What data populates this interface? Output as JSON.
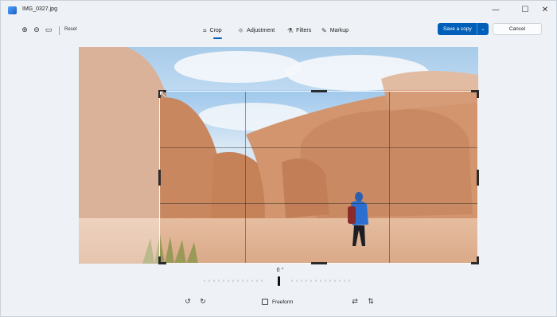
{
  "window": {
    "title": "IMG_0327.jpg",
    "controls": [
      "minimize-icon",
      "maximize-icon",
      "close-icon"
    ]
  },
  "toolbar": {
    "zoom_in_icon": "zoom-in-icon",
    "zoom_out_icon": "zoom-out-icon",
    "fit_icon": "fit-to-window-icon",
    "reset_label": "Reset",
    "tabs": [
      {
        "label": "Crop",
        "icon": "crop-icon",
        "selected": true
      },
      {
        "label": "Adjustment",
        "icon": "adjustment-icon",
        "selected": false
      },
      {
        "label": "Filters",
        "icon": "filters-icon",
        "selected": false
      },
      {
        "label": "Markup",
        "icon": "markup-pen-icon",
        "selected": false
      }
    ],
    "save_label": "Save a copy",
    "cancel_label": "Cancel"
  },
  "rotation": {
    "angle_label": "0 °"
  },
  "bottom": {
    "aspect_label": "Freeform",
    "icons": [
      "rotate-left-icon",
      "rotate-right-icon",
      "flip-horizontal-icon",
      "flip-vertical-icon"
    ]
  },
  "colors": {
    "accent": "#005fb8",
    "background": "#eef2f6"
  }
}
